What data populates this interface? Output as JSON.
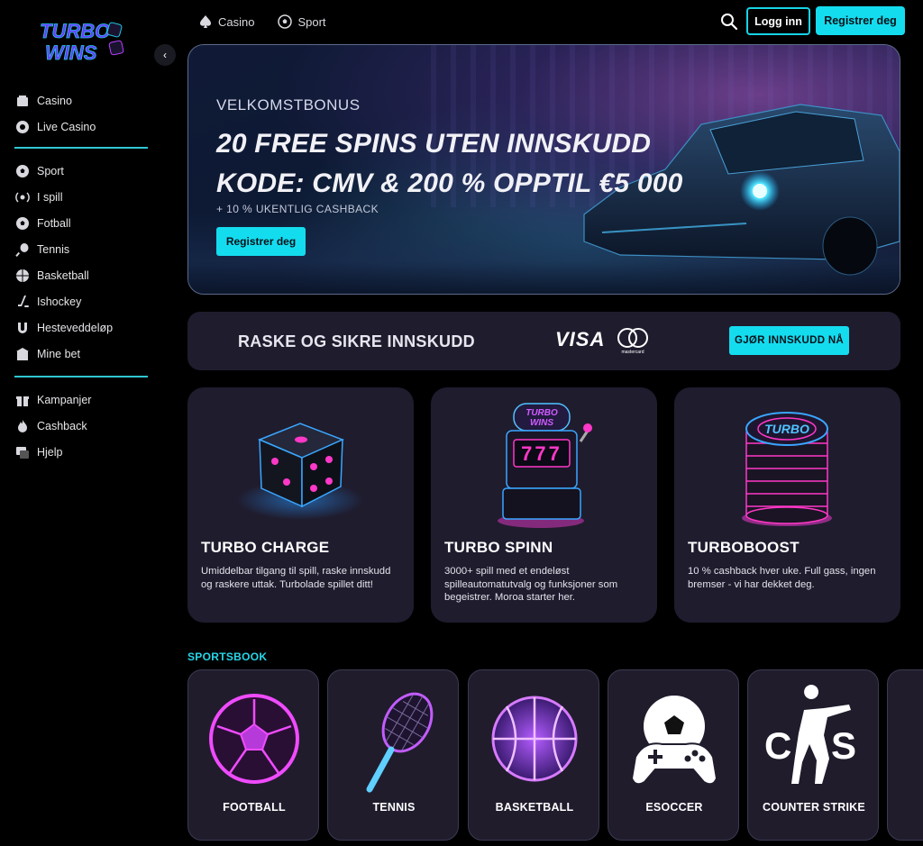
{
  "brand": {
    "logo_line1": "TURBO",
    "logo_line2": "WINS"
  },
  "sidebar": {
    "groups": [
      [
        {
          "label": "Casino",
          "icon": "casino-icon"
        },
        {
          "label": "Live Casino",
          "icon": "live-casino-icon"
        }
      ],
      [
        {
          "label": "Sport",
          "icon": "sport-icon"
        },
        {
          "label": "I spill",
          "icon": "live-icon"
        },
        {
          "label": "Fotball",
          "icon": "football-icon"
        },
        {
          "label": "Tennis",
          "icon": "tennis-icon"
        },
        {
          "label": "Basketball",
          "icon": "basketball-icon"
        },
        {
          "label": "Ishockey",
          "icon": "hockey-icon"
        },
        {
          "label": "Hesteveddeløp",
          "icon": "horseshoe-icon"
        },
        {
          "label": "Mine bet",
          "icon": "my-bets-icon"
        }
      ],
      [
        {
          "label": "Kampanjer",
          "icon": "gift-icon"
        },
        {
          "label": "Cashback",
          "icon": "flame-icon"
        },
        {
          "label": "Hjelp",
          "icon": "help-icon"
        }
      ]
    ]
  },
  "topnav": {
    "casino": "Casino",
    "sport": "Sport",
    "login": "Logg inn",
    "register": "Registrer deg"
  },
  "hero": {
    "eyebrow": "VELKOMSTBONUS",
    "line1": "20 FREE SPINS UTEN INNSKUDD",
    "line2": "KODE: CMV & 200 % OPPTIL €5 000",
    "sub": "+ 10 % UKENTLIG CASHBACK",
    "cta": "Registrer deg"
  },
  "deposit": {
    "title": "RASKE OG SIKRE INNSKUDD",
    "visa": "VISA",
    "mastercard": "mastercard",
    "cta": "GJØR INNSKUDD NÅ"
  },
  "features": [
    {
      "title": "TURBO CHARGE",
      "desc": "Umiddelbar tilgang til spill, raske innskudd og raskere uttak. Turbolade spillet ditt!"
    },
    {
      "title": "TURBO SPINN",
      "desc": "3000+ spill med et endeløst spilleautomatutvalg og funksjoner som begeistrer. Moroa starter her."
    },
    {
      "title": "TURBOBOOST",
      "desc": "10 % cashback hver uke. Full gass, ingen bremser - vi har dekket deg."
    }
  ],
  "feature_art": {
    "slot_logo1": "TURBO",
    "slot_logo2": "WINS",
    "slot_reels": "777",
    "chip_label": "TURBO"
  },
  "sportsbook": {
    "label": "SPORTSBOOK",
    "items": [
      "FOOTBALL",
      "TENNIS",
      "BASKETBALL",
      "ESOCCER",
      "COUNTER STRIKE"
    ],
    "cs_logo_left": "C",
    "cs_logo_right": "S"
  },
  "colors": {
    "accent": "#14dcef",
    "card_bg": "#1f1c2e",
    "divider": "#2fc7d2",
    "neon_pink": "#e93cff"
  }
}
